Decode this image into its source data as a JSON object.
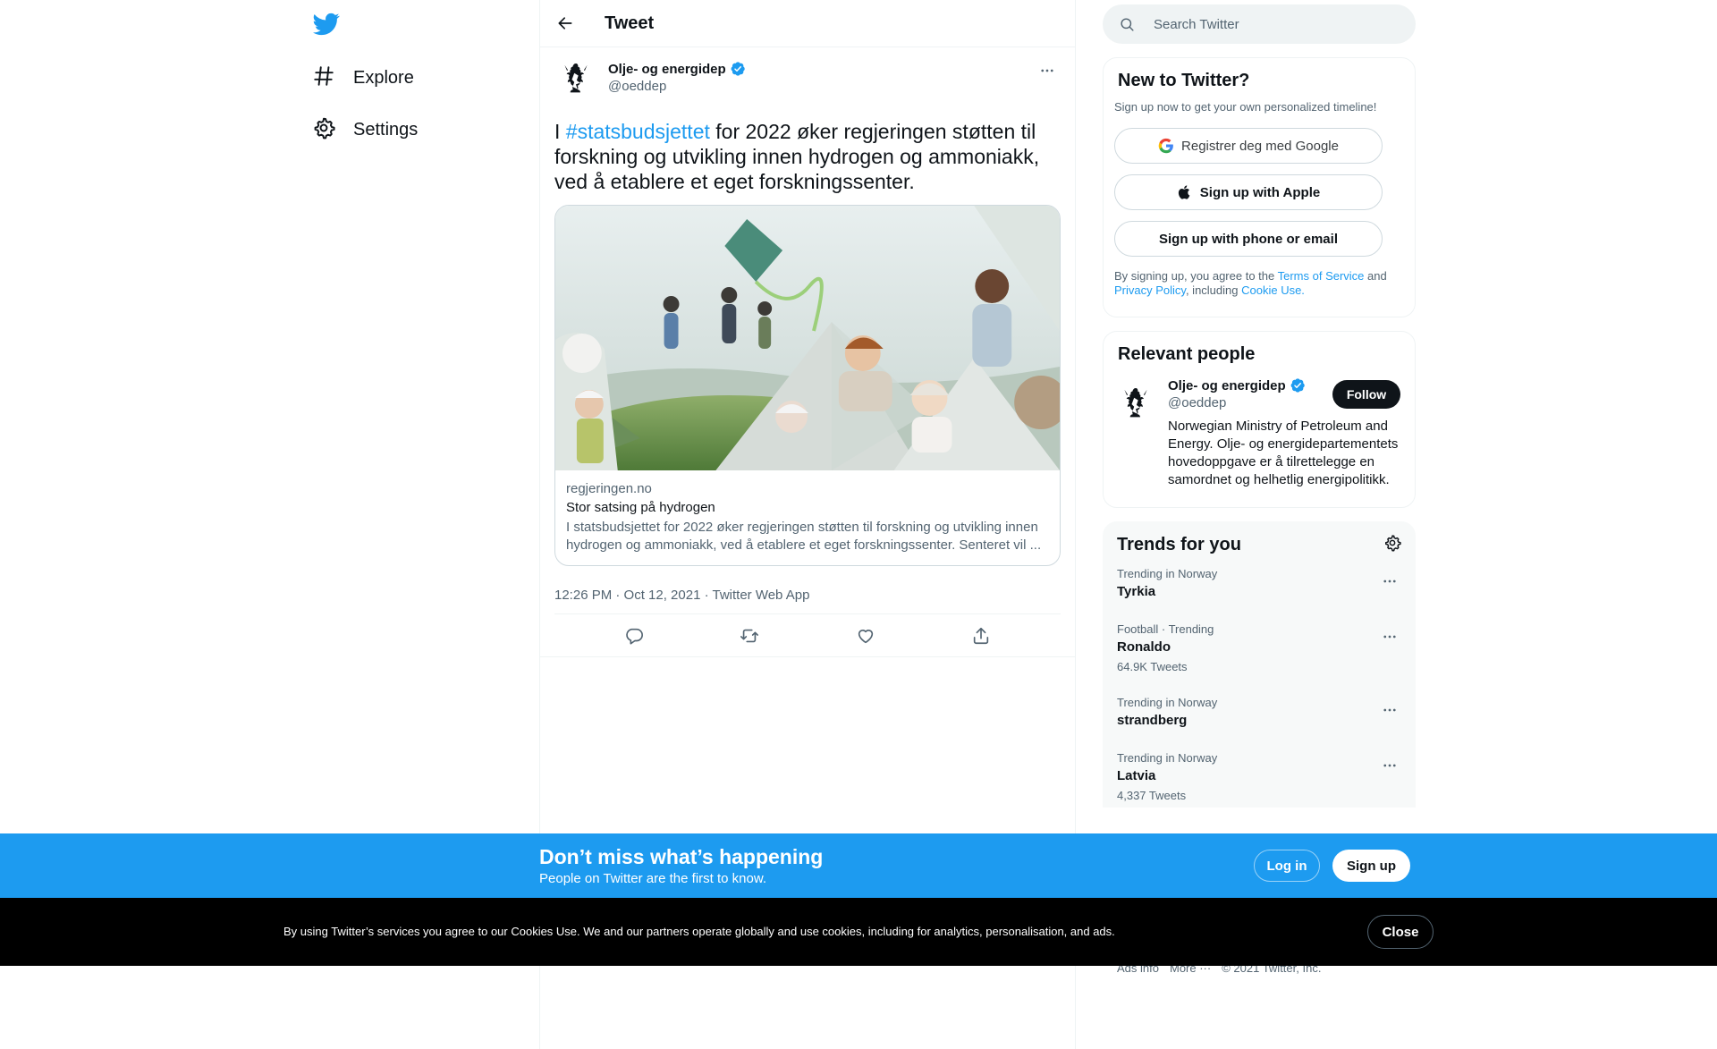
{
  "nav": {
    "explore_label": "Explore",
    "settings_label": "Settings"
  },
  "header": {
    "title": "Tweet"
  },
  "tweet": {
    "author_name": "Olje- og energidep",
    "author_handle": "@oeddep",
    "text_prefix": "I ",
    "hashtag": "#statsbudsjettet",
    "text_rest": " for 2022 øker regjeringen støtten til forskning og utvikling innen hydrogen og ammoniakk, ved å etablere et eget forskningssenter.",
    "card": {
      "domain": "regjeringen.no",
      "title": "Stor satsing på hydrogen",
      "description": "I statsbudsjettet for 2022 øker regjeringen støtten til forskning og utvikling innen hydrogen og ammoniakk, ved å etablere et eget forskningssenter. Senteret vil ..."
    },
    "meta": "12:26 PM · Oct 12, 2021 · Twitter Web App"
  },
  "search": {
    "placeholder": "Search Twitter"
  },
  "new_to_twitter": {
    "title": "New to Twitter?",
    "subtitle": "Sign up now to get your own personalized timeline!",
    "google_label": "Registrer deg med Google",
    "apple_label": "Sign up with Apple",
    "phone_label": "Sign up with phone or email",
    "legal_1": "By signing up, you agree to the ",
    "terms_link": "Terms of Service",
    "legal_2": " and ",
    "privacy_link": "Privacy Policy",
    "legal_3": ", including ",
    "cookie_link": "Cookie Use."
  },
  "relevant_people": {
    "title": "Relevant people",
    "name": "Olje- og energidep",
    "handle": "@oeddep",
    "follow_label": "Follow",
    "bio": "Norwegian Ministry of Petroleum and Energy. Olje- og energidepartementets hovedoppgave er å tilrettelegge en samordnet og helhetlig energipolitikk."
  },
  "trends": {
    "title": "Trends for you",
    "items": [
      {
        "context": "Trending in Norway",
        "name": "Tyrkia",
        "count": ""
      },
      {
        "context": "Football · Trending",
        "name": "Ronaldo",
        "count": "64.9K Tweets"
      },
      {
        "context": "Trending in Norway",
        "name": "strandberg",
        "count": ""
      },
      {
        "context": "Trending in Norway",
        "name": "Latvia",
        "count": "4,337 Tweets"
      }
    ]
  },
  "footer": {
    "ads_info": "Ads info",
    "more": "More ···",
    "copyright": "© 2021 Twitter, Inc."
  },
  "bottom_bar": {
    "title": "Don’t miss what’s happening",
    "subtitle": "People on Twitter are the first to know.",
    "login_label": "Log in",
    "signup_label": "Sign up"
  },
  "cookie_bar": {
    "text": "By using Twitter’s services you agree to our Cookies Use. We and our partners operate globally and use cookies, including for analytics, personalisation, and ads.",
    "close_label": "Close"
  },
  "colors": {
    "accent": "#1d9bf0",
    "text": "#0f1419",
    "secondary": "#536471"
  }
}
